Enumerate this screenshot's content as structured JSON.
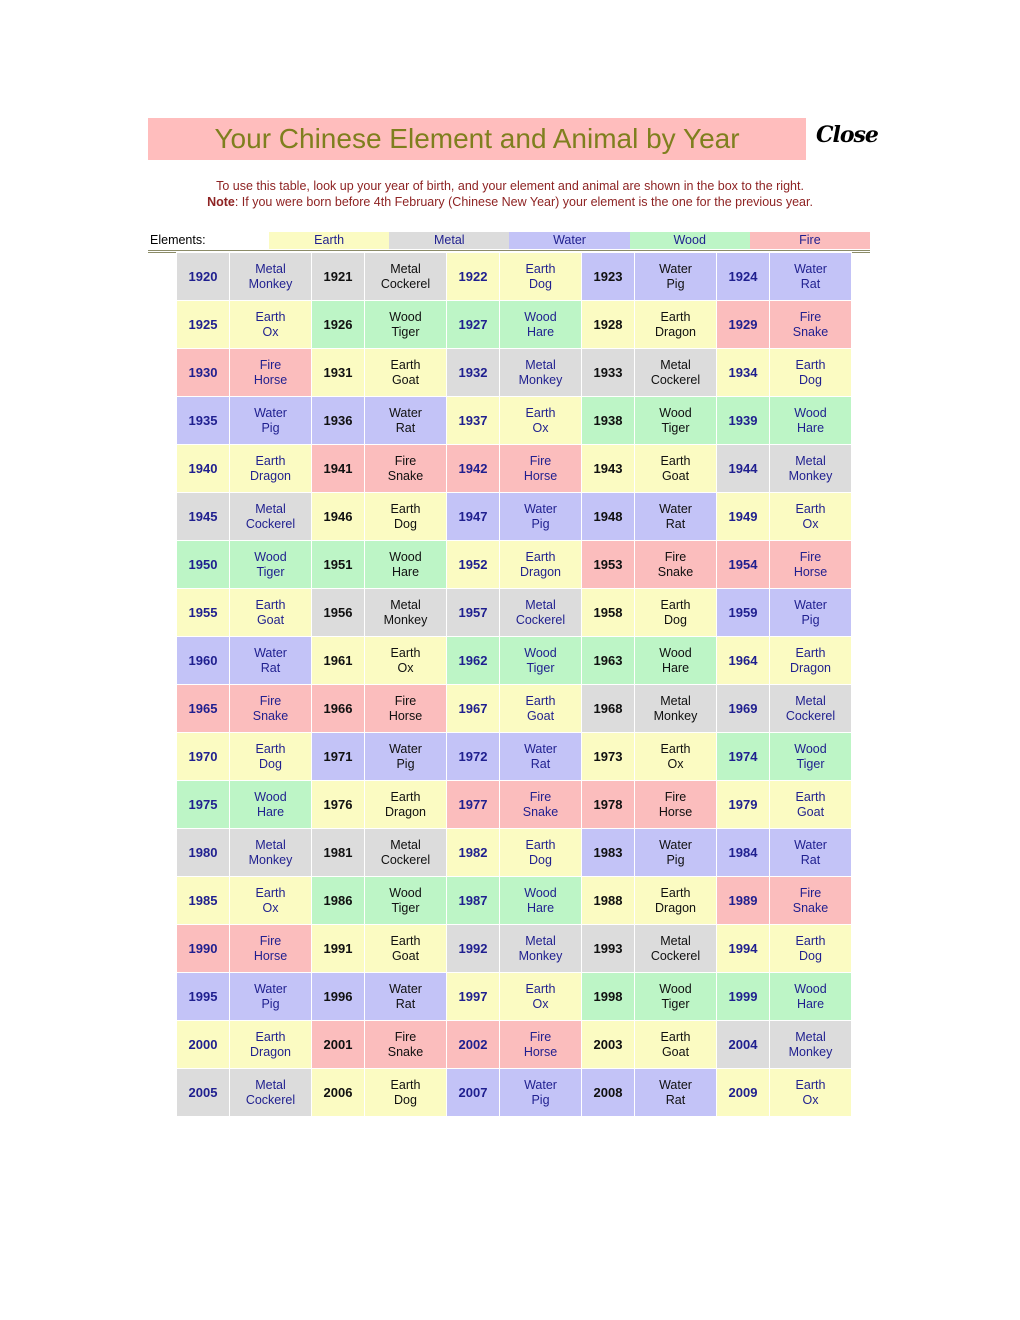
{
  "header": {
    "title": "Your Chinese Element and Animal by Year",
    "close_label": "Close",
    "title_bg_color": "#FFBDBD",
    "title_text_color": "#7F7F1E"
  },
  "instructions": {
    "line1": "To use this table, look up your year of birth, and your element and animal are shown in the box to the right.",
    "note_label": "Note",
    "note_body": ": If you were born before 4th February (Chinese New Year) your element is the one for the previous year.",
    "text_color": "#8E2323"
  },
  "legend": {
    "label": "Elements:",
    "items": [
      {
        "name": "Earth",
        "color": "#FBFBC2"
      },
      {
        "name": "Metal",
        "color": "#DCDCDC"
      },
      {
        "name": "Water",
        "color": "#C3C3F7"
      },
      {
        "name": "Wood",
        "color": "#BDF5C6"
      },
      {
        "name": "Fire",
        "color": "#FBBDBD"
      }
    ]
  },
  "table": {
    "rows": [
      [
        {
          "year": "1920",
          "element": "Metal",
          "animal": "Monkey",
          "bg": "metal",
          "text": "navy"
        },
        {
          "year": "1921",
          "element": "Metal",
          "animal": "Cockerel",
          "bg": "metal",
          "text": "black"
        },
        {
          "year": "1922",
          "element": "Earth",
          "animal": "Dog",
          "bg": "earth",
          "text": "navy"
        },
        {
          "year": "1923",
          "element": "Water",
          "animal": "Pig",
          "bg": "water",
          "text": "black"
        },
        {
          "year": "1924",
          "element": "Water",
          "animal": "Rat",
          "bg": "water",
          "text": "navy"
        }
      ],
      [
        {
          "year": "1925",
          "element": "Earth",
          "animal": "Ox",
          "bg": "earth",
          "text": "navy"
        },
        {
          "year": "1926",
          "element": "Wood",
          "animal": "Tiger",
          "bg": "wood",
          "text": "black"
        },
        {
          "year": "1927",
          "element": "Wood",
          "animal": "Hare",
          "bg": "wood",
          "text": "navy"
        },
        {
          "year": "1928",
          "element": "Earth",
          "animal": "Dragon",
          "bg": "earth",
          "text": "black"
        },
        {
          "year": "1929",
          "element": "Fire",
          "animal": "Snake",
          "bg": "fire",
          "text": "navy"
        }
      ],
      [
        {
          "year": "1930",
          "element": "Fire",
          "animal": "Horse",
          "bg": "fire",
          "text": "navy"
        },
        {
          "year": "1931",
          "element": "Earth",
          "animal": "Goat",
          "bg": "earth",
          "text": "black"
        },
        {
          "year": "1932",
          "element": "Metal",
          "animal": "Monkey",
          "bg": "metal",
          "text": "navy"
        },
        {
          "year": "1933",
          "element": "Metal",
          "animal": "Cockerel",
          "bg": "metal",
          "text": "black"
        },
        {
          "year": "1934",
          "element": "Earth",
          "animal": "Dog",
          "bg": "earth",
          "text": "navy"
        }
      ],
      [
        {
          "year": "1935",
          "element": "Water",
          "animal": "Pig",
          "bg": "water",
          "text": "navy"
        },
        {
          "year": "1936",
          "element": "Water",
          "animal": "Rat",
          "bg": "water",
          "text": "black"
        },
        {
          "year": "1937",
          "element": "Earth",
          "animal": "Ox",
          "bg": "earth",
          "text": "navy"
        },
        {
          "year": "1938",
          "element": "Wood",
          "animal": "Tiger",
          "bg": "wood",
          "text": "black"
        },
        {
          "year": "1939",
          "element": "Wood",
          "animal": "Hare",
          "bg": "wood",
          "text": "navy"
        }
      ],
      [
        {
          "year": "1940",
          "element": "Earth",
          "animal": "Dragon",
          "bg": "earth",
          "text": "navy"
        },
        {
          "year": "1941",
          "element": "Fire",
          "animal": "Snake",
          "bg": "fire",
          "text": "black"
        },
        {
          "year": "1942",
          "element": "Fire",
          "animal": "Horse",
          "bg": "fire",
          "text": "navy"
        },
        {
          "year": "1943",
          "element": "Earth",
          "animal": "Goat",
          "bg": "earth",
          "text": "black"
        },
        {
          "year": "1944",
          "element": "Metal",
          "animal": "Monkey",
          "bg": "metal",
          "text": "navy"
        }
      ],
      [
        {
          "year": "1945",
          "element": "Metal",
          "animal": "Cockerel",
          "bg": "metal",
          "text": "navy"
        },
        {
          "year": "1946",
          "element": "Earth",
          "animal": "Dog",
          "bg": "earth",
          "text": "black"
        },
        {
          "year": "1947",
          "element": "Water",
          "animal": "Pig",
          "bg": "water",
          "text": "navy"
        },
        {
          "year": "1948",
          "element": "Water",
          "animal": "Rat",
          "bg": "water",
          "text": "black"
        },
        {
          "year": "1949",
          "element": "Earth",
          "animal": "Ox",
          "bg": "earth",
          "text": "navy"
        }
      ],
      [
        {
          "year": "1950",
          "element": "Wood",
          "animal": "Tiger",
          "bg": "wood",
          "text": "navy"
        },
        {
          "year": "1951",
          "element": "Wood",
          "animal": "Hare",
          "bg": "wood",
          "text": "black"
        },
        {
          "year": "1952",
          "element": "Earth",
          "animal": "Dragon",
          "bg": "earth",
          "text": "navy"
        },
        {
          "year": "1953",
          "element": "Fire",
          "animal": "Snake",
          "bg": "fire",
          "text": "black"
        },
        {
          "year": "1954",
          "element": "Fire",
          "animal": "Horse",
          "bg": "fire",
          "text": "navy"
        }
      ],
      [
        {
          "year": "1955",
          "element": "Earth",
          "animal": "Goat",
          "bg": "earth",
          "text": "navy"
        },
        {
          "year": "1956",
          "element": "Metal",
          "animal": "Monkey",
          "bg": "metal",
          "text": "black"
        },
        {
          "year": "1957",
          "element": "Metal",
          "animal": "Cockerel",
          "bg": "metal",
          "text": "navy"
        },
        {
          "year": "1958",
          "element": "Earth",
          "animal": "Dog",
          "bg": "earth",
          "text": "black"
        },
        {
          "year": "1959",
          "element": "Water",
          "animal": "Pig",
          "bg": "water",
          "text": "navy"
        }
      ],
      [
        {
          "year": "1960",
          "element": "Water",
          "animal": "Rat",
          "bg": "water",
          "text": "navy"
        },
        {
          "year": "1961",
          "element": "Earth",
          "animal": "Ox",
          "bg": "earth",
          "text": "black"
        },
        {
          "year": "1962",
          "element": "Wood",
          "animal": "Tiger",
          "bg": "wood",
          "text": "navy"
        },
        {
          "year": "1963",
          "element": "Wood",
          "animal": "Hare",
          "bg": "wood",
          "text": "black"
        },
        {
          "year": "1964",
          "element": "Earth",
          "animal": "Dragon",
          "bg": "earth",
          "text": "navy"
        }
      ],
      [
        {
          "year": "1965",
          "element": "Fire",
          "animal": "Snake",
          "bg": "fire",
          "text": "navy"
        },
        {
          "year": "1966",
          "element": "Fire",
          "animal": "Horse",
          "bg": "fire",
          "text": "black"
        },
        {
          "year": "1967",
          "element": "Earth",
          "animal": "Goat",
          "bg": "earth",
          "text": "navy"
        },
        {
          "year": "1968",
          "element": "Metal",
          "animal": "Monkey",
          "bg": "metal",
          "text": "black"
        },
        {
          "year": "1969",
          "element": "Metal",
          "animal": "Cockerel",
          "bg": "metal",
          "text": "navy"
        }
      ],
      [
        {
          "year": "1970",
          "element": "Earth",
          "animal": "Dog",
          "bg": "earth",
          "text": "navy"
        },
        {
          "year": "1971",
          "element": "Water",
          "animal": "Pig",
          "bg": "water",
          "text": "black"
        },
        {
          "year": "1972",
          "element": "Water",
          "animal": "Rat",
          "bg": "water",
          "text": "navy"
        },
        {
          "year": "1973",
          "element": "Earth",
          "animal": "Ox",
          "bg": "earth",
          "text": "black"
        },
        {
          "year": "1974",
          "element": "Wood",
          "animal": "Tiger",
          "bg": "wood",
          "text": "navy"
        }
      ],
      [
        {
          "year": "1975",
          "element": "Wood",
          "animal": "Hare",
          "bg": "wood",
          "text": "navy"
        },
        {
          "year": "1976",
          "element": "Earth",
          "animal": "Dragon",
          "bg": "earth",
          "text": "black"
        },
        {
          "year": "1977",
          "element": "Fire",
          "animal": "Snake",
          "bg": "fire",
          "text": "navy"
        },
        {
          "year": "1978",
          "element": "Fire",
          "animal": "Horse",
          "bg": "fire",
          "text": "black"
        },
        {
          "year": "1979",
          "element": "Earth",
          "animal": "Goat",
          "bg": "earth",
          "text": "navy"
        }
      ],
      [
        {
          "year": "1980",
          "element": "Metal",
          "animal": "Monkey",
          "bg": "metal",
          "text": "navy"
        },
        {
          "year": "1981",
          "element": "Metal",
          "animal": "Cockerel",
          "bg": "metal",
          "text": "black"
        },
        {
          "year": "1982",
          "element": "Earth",
          "animal": "Dog",
          "bg": "earth",
          "text": "navy"
        },
        {
          "year": "1983",
          "element": "Water",
          "animal": "Pig",
          "bg": "water",
          "text": "black"
        },
        {
          "year": "1984",
          "element": "Water",
          "animal": "Rat",
          "bg": "water",
          "text": "navy"
        }
      ],
      [
        {
          "year": "1985",
          "element": "Earth",
          "animal": "Ox",
          "bg": "earth",
          "text": "navy"
        },
        {
          "year": "1986",
          "element": "Wood",
          "animal": "Tiger",
          "bg": "wood",
          "text": "black"
        },
        {
          "year": "1987",
          "element": "Wood",
          "animal": "Hare",
          "bg": "wood",
          "text": "navy"
        },
        {
          "year": "1988",
          "element": "Earth",
          "animal": "Dragon",
          "bg": "earth",
          "text": "black"
        },
        {
          "year": "1989",
          "element": "Fire",
          "animal": "Snake",
          "bg": "fire",
          "text": "navy"
        }
      ],
      [
        {
          "year": "1990",
          "element": "Fire",
          "animal": "Horse",
          "bg": "fire",
          "text": "navy"
        },
        {
          "year": "1991",
          "element": "Earth",
          "animal": "Goat",
          "bg": "earth",
          "text": "black"
        },
        {
          "year": "1992",
          "element": "Metal",
          "animal": "Monkey",
          "bg": "metal",
          "text": "navy"
        },
        {
          "year": "1993",
          "element": "Metal",
          "animal": "Cockerel",
          "bg": "metal",
          "text": "black"
        },
        {
          "year": "1994",
          "element": "Earth",
          "animal": "Dog",
          "bg": "earth",
          "text": "navy"
        }
      ],
      [
        {
          "year": "1995",
          "element": "Water",
          "animal": "Pig",
          "bg": "water",
          "text": "navy"
        },
        {
          "year": "1996",
          "element": "Water",
          "animal": "Rat",
          "bg": "water",
          "text": "black"
        },
        {
          "year": "1997",
          "element": "Earth",
          "animal": "Ox",
          "bg": "earth",
          "text": "navy"
        },
        {
          "year": "1998",
          "element": "Wood",
          "animal": "Tiger",
          "bg": "wood",
          "text": "black"
        },
        {
          "year": "1999",
          "element": "Wood",
          "animal": "Hare",
          "bg": "wood",
          "text": "navy"
        }
      ],
      [
        {
          "year": "2000",
          "element": "Earth",
          "animal": "Dragon",
          "bg": "earth",
          "text": "navy"
        },
        {
          "year": "2001",
          "element": "Fire",
          "animal": "Snake",
          "bg": "fire",
          "text": "black"
        },
        {
          "year": "2002",
          "element": "Fire",
          "animal": "Horse",
          "bg": "fire",
          "text": "navy"
        },
        {
          "year": "2003",
          "element": "Earth",
          "animal": "Goat",
          "bg": "earth",
          "text": "black"
        },
        {
          "year": "2004",
          "element": "Metal",
          "animal": "Monkey",
          "bg": "metal",
          "text": "navy"
        }
      ],
      [
        {
          "year": "2005",
          "element": "Metal",
          "animal": "Cockerel",
          "bg": "metal",
          "text": "navy"
        },
        {
          "year": "2006",
          "element": "Earth",
          "animal": "Dog",
          "bg": "earth",
          "text": "black"
        },
        {
          "year": "2007",
          "element": "Water",
          "animal": "Pig",
          "bg": "water",
          "text": "navy"
        },
        {
          "year": "2008",
          "element": "Water",
          "animal": "Rat",
          "bg": "water",
          "text": "black"
        },
        {
          "year": "2009",
          "element": "Earth",
          "animal": "Ox",
          "bg": "earth",
          "text": "navy"
        }
      ]
    ]
  }
}
